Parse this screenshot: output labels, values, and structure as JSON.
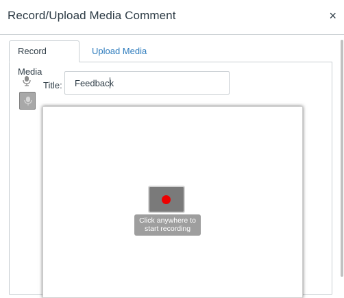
{
  "dialog": {
    "title": "Record/Upload Media Comment",
    "close_glyph": "×"
  },
  "tabs": [
    {
      "label": "Record Media",
      "active": true
    },
    {
      "label": "Upload Media",
      "active": false
    }
  ],
  "recorder": {
    "icons": [
      "microphone-icon",
      "microphone-toggle-icon"
    ],
    "title_label": "Title:",
    "title_value": "Feedback",
    "record_hint": "Click anywhere to\nstart recording",
    "record_dot_color": "#ee0000"
  },
  "colors": {
    "link": "#2b7abc",
    "text": "#2d3b45",
    "border": "#c7cdd1"
  }
}
